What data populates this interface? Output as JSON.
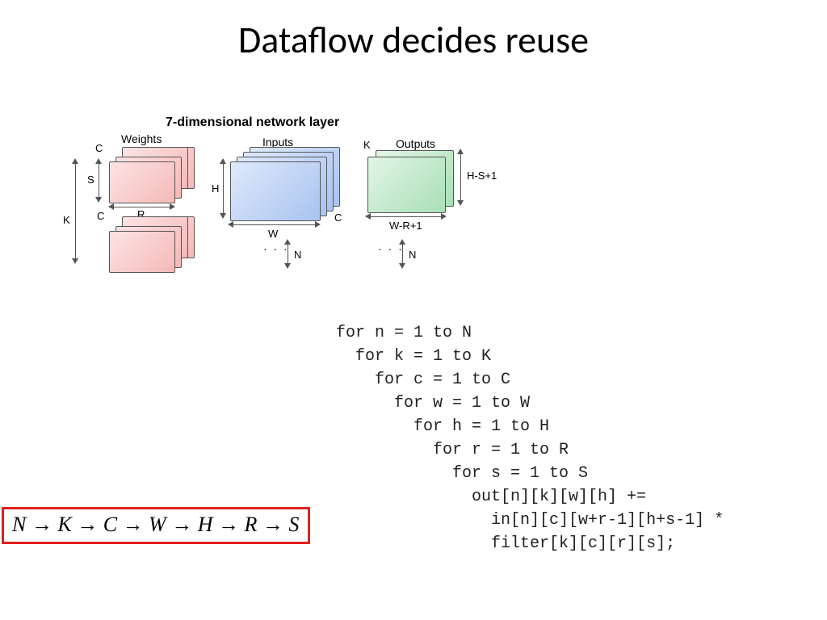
{
  "title": "Dataflow decides reuse",
  "diagram": {
    "caption": "7-dimensional network layer",
    "groups": {
      "weights": {
        "title": "Weights",
        "dims": {
          "C": "C",
          "S": "S",
          "K": "K",
          "R": "R"
        }
      },
      "inputs": {
        "title": "Inputs",
        "dims": {
          "H": "H",
          "W": "W",
          "C": "C",
          "N": "N"
        }
      },
      "outputs": {
        "title": "Outputs",
        "dims": {
          "K": "K",
          "H": "H-S+1",
          "W": "W-R+1",
          "N": "N"
        }
      }
    }
  },
  "code": {
    "l1": "for n = 1 to N",
    "l2": "  for k = 1 to K",
    "l3": "    for c = 1 to C",
    "l4": "      for w = 1 to W",
    "l5": "        for h = 1 to H",
    "l6": "          for r = 1 to R",
    "l7": "            for s = 1 to S",
    "l8": "              out[n][k][w][h] +=",
    "l9": "                in[n][c][w+r-1][h+s-1] *",
    "l10": "                filter[k][c][r][s];"
  },
  "ordering": {
    "seq": [
      "N",
      "K",
      "C",
      "W",
      "H",
      "R",
      "S"
    ],
    "arrow": "→"
  }
}
